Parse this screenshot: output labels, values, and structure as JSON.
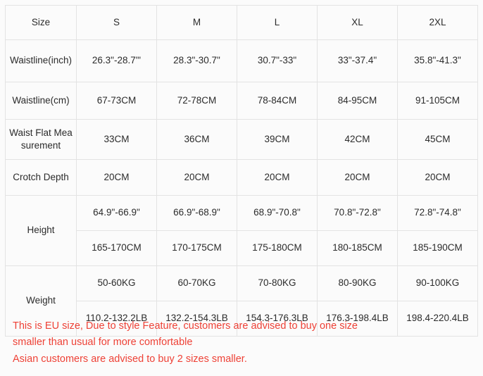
{
  "table": {
    "columns": [
      "Size",
      "S",
      "M",
      "L",
      "XL",
      "2XL"
    ],
    "rows": [
      {
        "label": "Waistline(inch)",
        "values": [
          "26.3\"-28.7\"'",
          "28.3\"-30.7\"",
          "30.7\"-33\"",
          "33\"-37.4\"",
          "35.8\"-41.3\""
        ]
      },
      {
        "label": "Waistline(cm)",
        "values": [
          "67-73CM",
          "72-78CM",
          "78-84CM",
          "84-95CM",
          "91-105CM"
        ]
      },
      {
        "label": "Waist Flat Measurement",
        "values": [
          "33CM",
          "36CM",
          "39CM",
          "42CM",
          "45CM"
        ]
      },
      {
        "label": "Crotch Depth",
        "values": [
          "20CM",
          "20CM",
          "20CM",
          "20CM",
          "20CM"
        ]
      }
    ],
    "grouped_rows": [
      {
        "label": "Height",
        "sub_rows": [
          {
            "values": [
              "64.9\"-66.9\"",
              "66.9\"-68.9\"",
              "68.9\"-70.8\"",
              "70.8\"-72.8\"",
              "72.8\"-74.8\""
            ]
          },
          {
            "values": [
              "165-170CM",
              "170-175CM",
              "175-180CM",
              "180-185CM",
              "185-190CM"
            ]
          }
        ]
      },
      {
        "label": "Weight",
        "sub_rows": [
          {
            "values": [
              "50-60KG",
              "60-70KG",
              "70-80KG",
              "80-90KG",
              "90-100KG"
            ]
          },
          {
            "values": [
              "110.2-132.2LB",
              "132.2-154.3LB",
              "154.3-176.3LB",
              "176.3-198.4LB",
              "198.4-220.4LB"
            ]
          }
        ]
      }
    ]
  },
  "footnote": {
    "line1": "This is EU size, Due to style Feature, customers are advised to buy one size",
    "line2": "smaller than usual for more comfortable",
    "line3": "Asian customers are advised to buy 2 sizes smaller.",
    "color": "#ee4136"
  }
}
